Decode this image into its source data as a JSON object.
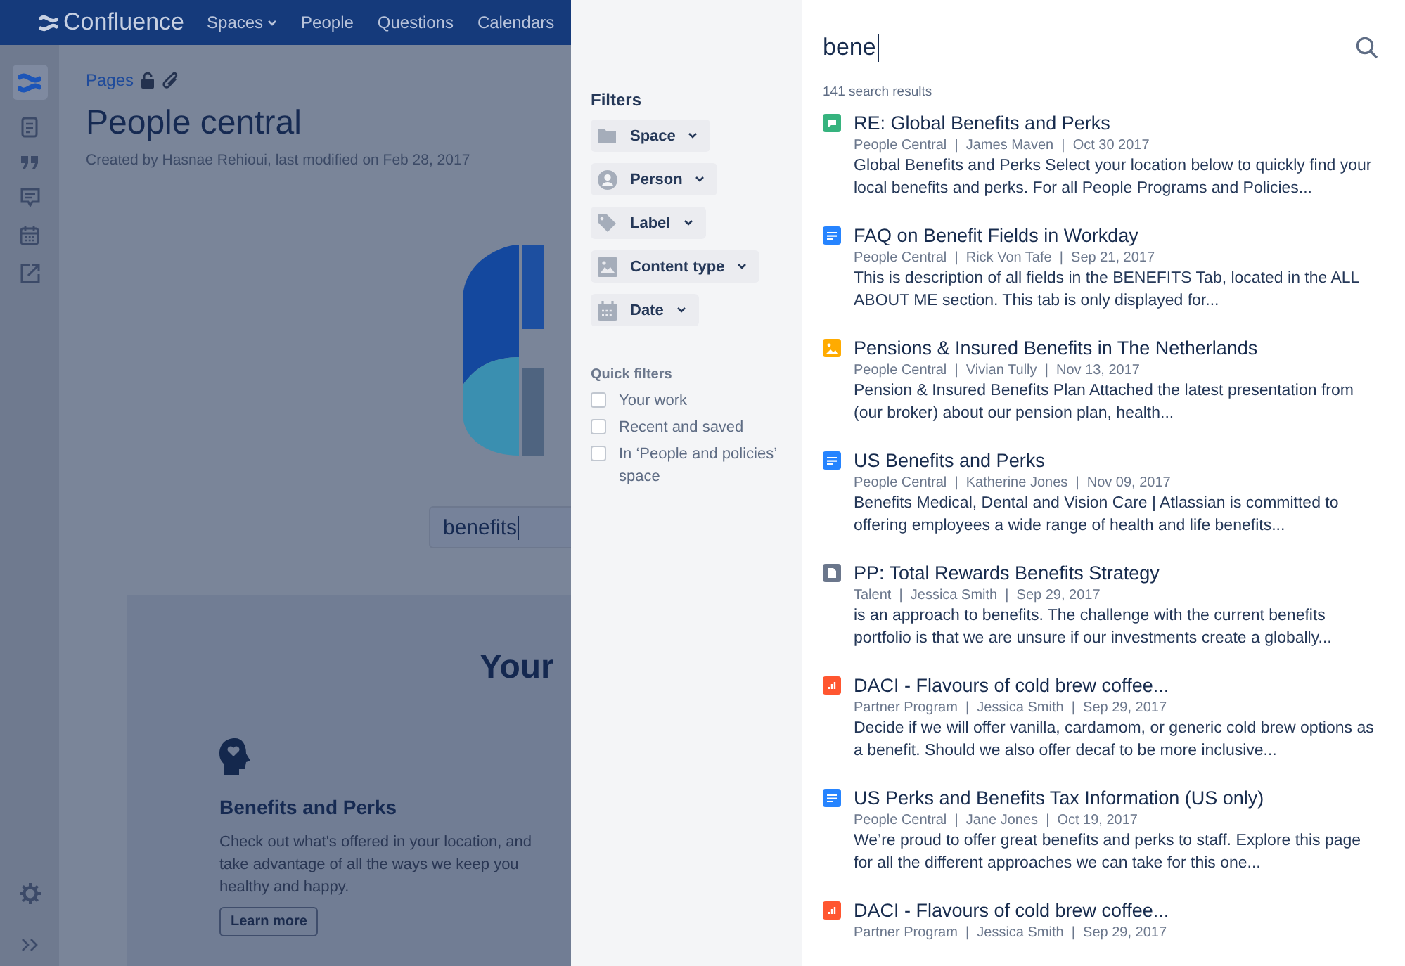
{
  "top_nav": {
    "logo": "Confluence",
    "items": [
      {
        "label": "Spaces",
        "dropdown": true
      },
      {
        "label": "People",
        "dropdown": false
      },
      {
        "label": "Questions",
        "dropdown": false
      },
      {
        "label": "Calendars",
        "dropdown": false
      }
    ]
  },
  "page": {
    "breadcrumb": "Pages",
    "title": "People central",
    "byline": "Created by Hasnae Rehioui, last modified on Feb 28, 2017",
    "search_value": "benefits",
    "section_heading": "Your",
    "card": {
      "title": "Benefits and Perks",
      "text": "Check out what's offered in your location, and take advantage of all the ways we keep you healthy and happy.",
      "button": "Learn more"
    }
  },
  "filters": {
    "heading": "Filters",
    "items": [
      {
        "label": "Space",
        "kind": "space"
      },
      {
        "label": "Person",
        "kind": "person"
      },
      {
        "label": "Label",
        "kind": "label"
      },
      {
        "label": "Content type",
        "kind": "content"
      },
      {
        "label": "Date",
        "kind": "date"
      }
    ],
    "quick_heading": "Quick filters",
    "quick": [
      {
        "label": "Your work",
        "checked": false
      },
      {
        "label": "Recent and saved",
        "checked": false
      },
      {
        "label": "In ‘People and policies’ space",
        "checked": false
      }
    ]
  },
  "search": {
    "value": "bene",
    "count": "141 search results",
    "results": [
      {
        "kind": "comment",
        "title": "RE: Global Benefits and Perks",
        "meta": "People Central  |  James Maven  |  Oct 30 2017",
        "excerpt": "Global Benefits and Perks Select your location below to quickly find your local benefits and perks. For all People Programs and Policies..."
      },
      {
        "kind": "page",
        "title": "FAQ on Benefit Fields in Workday",
        "meta": "People Central  |  Rick Von Tafe  |  Sep 21, 2017",
        "excerpt": "This is description of all fields in the BENEFITS Tab, located in the ALL ABOUT ME section. This tab is only displayed for..."
      },
      {
        "kind": "image",
        "title": "Pensions & Insured Benefits in The Netherlands",
        "meta": "People Central  |  Vivian Tully  |  Nov 13, 2017",
        "excerpt": "Pension & Insured Benefits Plan Attached the latest presentation from (our broker) about our pension plan, health..."
      },
      {
        "kind": "page",
        "title": "US Benefits and Perks",
        "meta": "People Central  |  Katherine Jones  |  Nov 09, 2017",
        "excerpt": "Benefits Medical, Dental and Vision Care | Atlassian is committed to offering employees a wide range of health and life benefits..."
      },
      {
        "kind": "file",
        "title": "PP: Total Rewards Benefits Strategy",
        "meta": "Talent  |  Jessica Smith  |  Sep 29, 2017",
        "excerpt": "is an approach to benefits. The challenge with the current benefits portfolio is that we are unsure if our investments create a globally..."
      },
      {
        "kind": "decision",
        "title": "DACI - Flavours of cold brew coffee...",
        "meta": "Partner Program  |  Jessica Smith  |  Sep 29, 2017",
        "excerpt": "Decide if we will offer vanilla, cardamom, or generic cold brew options as a benefit. Should we also offer decaf to be more inclusive..."
      },
      {
        "kind": "page",
        "title": "US Perks and Benefits Tax Information (US only)",
        "meta": "People Central  |  Jane Jones  |  Oct 19, 2017",
        "excerpt": "We’re proud to offer great benefits and perks to staff. Explore this page for all the different approaches we can take for this one..."
      },
      {
        "kind": "decision",
        "title": "DACI - Flavours of cold brew coffee...",
        "meta": "Partner Program  |  Jessica Smith  |  Sep 29, 2017"
      }
    ]
  }
}
